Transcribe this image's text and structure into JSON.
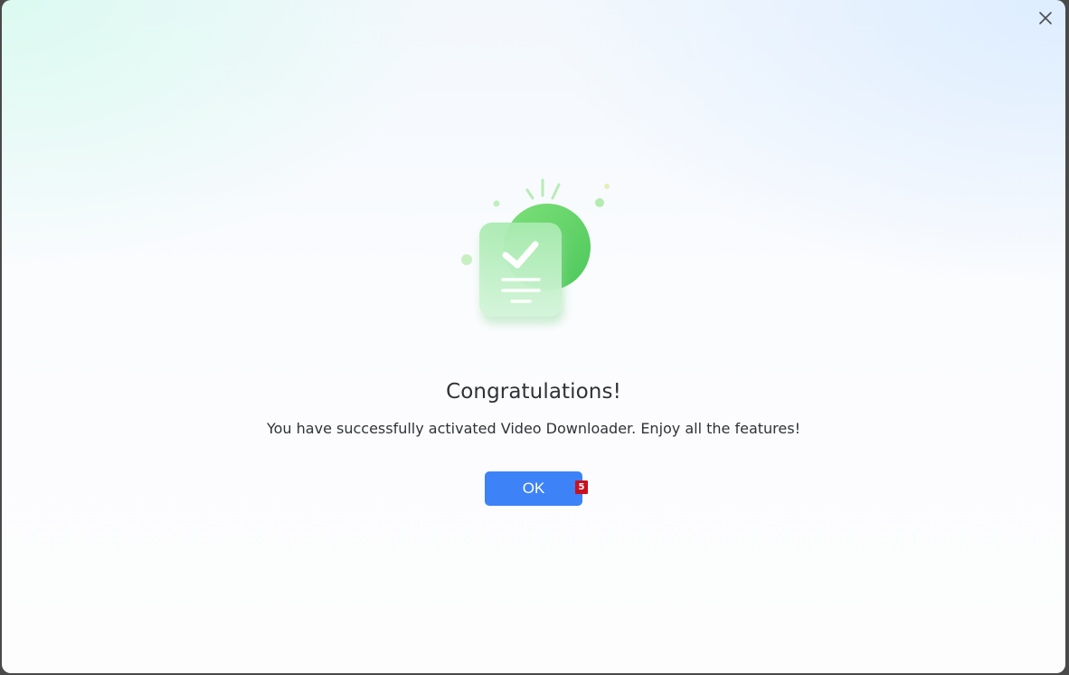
{
  "dialog": {
    "title": "Congratulations!",
    "message": "You have successfully activated Video Downloader. Enjoy all the features!",
    "ok_label": "OK",
    "badge": "5",
    "close_icon": "close-icon",
    "illustration_icon": "checklist-success-icon"
  },
  "colors": {
    "primary": "#3d82f7",
    "success": "#5ed35f",
    "badge": "#c9101e",
    "text": "#2f3237"
  }
}
